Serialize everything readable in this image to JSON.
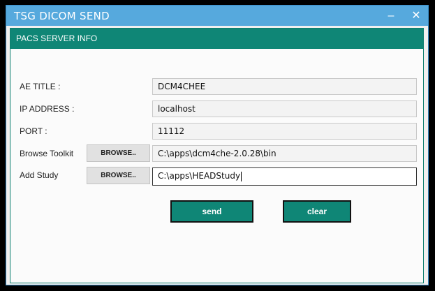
{
  "window": {
    "title": "TSG DICOM SEND",
    "minimize_glyph": "–",
    "close_glyph": "✕"
  },
  "panel": {
    "header": "PACS SERVER INFO"
  },
  "form": {
    "ae_title_label": "AE TITLE :",
    "ae_title_value": "DCM4CHEE",
    "ip_address_label": "IP ADDRESS :",
    "ip_address_value": "localhost",
    "port_label": "PORT :",
    "port_value": "11112",
    "browse_toolkit_label": "Browse Toolkit",
    "browse_toolkit_button": "BROWSE..",
    "browse_toolkit_value": "C:\\apps\\dcm4che-2.0.28\\bin",
    "add_study_label": "Add Study",
    "add_study_button": "BROWSE..",
    "add_study_value": "C:\\apps\\HEADStudy"
  },
  "actions": {
    "send_label": "send",
    "clear_label": "clear"
  },
  "colors": {
    "titlebar": "#56a9dd",
    "accent": "#0f8676"
  },
  "icons": {
    "minimize": "minimize-icon",
    "close": "close-icon"
  }
}
